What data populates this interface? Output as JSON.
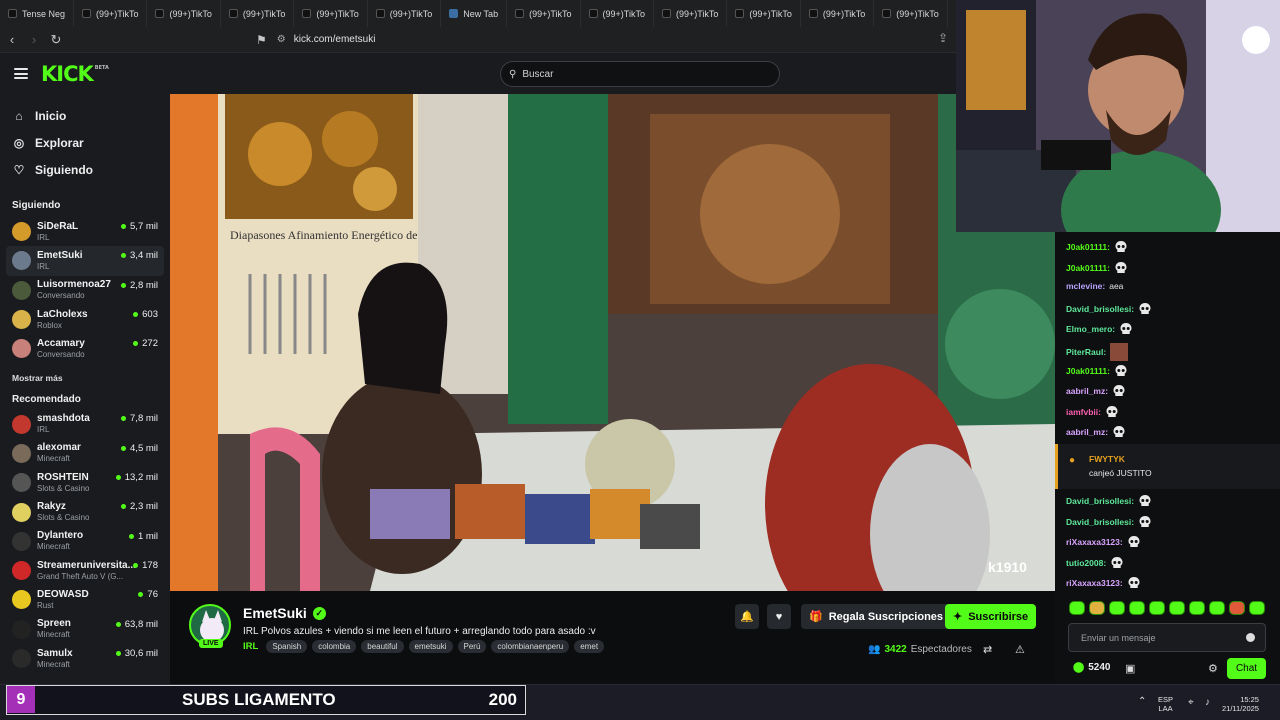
{
  "browser": {
    "tabs": [
      {
        "label": "Tense Neg",
        "icon": "tense-icon"
      },
      {
        "label": "(99+)TikTo",
        "icon": "tiktok-icon"
      },
      {
        "label": "(99+)TikTo",
        "icon": "tiktok-icon"
      },
      {
        "label": "(99+)TikTo",
        "icon": "tiktok-icon"
      },
      {
        "label": "(99+)TikTo",
        "icon": "tiktok-icon"
      },
      {
        "label": "(99+)TikTo",
        "icon": "tiktok-icon"
      },
      {
        "label": "New Tab",
        "icon": "new-tab-icon"
      },
      {
        "label": "(99+)TikTo",
        "icon": "tiktok-icon"
      },
      {
        "label": "(99+)TikTo",
        "icon": "tiktok-icon"
      },
      {
        "label": "(99+)TikTo",
        "icon": "tiktok-icon"
      },
      {
        "label": "(99+)TikTo",
        "icon": "tiktok-icon"
      },
      {
        "label": "(99+)TikTo",
        "icon": "tiktok-icon"
      },
      {
        "label": "(99+)TikTo",
        "icon": "tiktok-icon"
      }
    ],
    "url": "kick.com/emetsuki"
  },
  "header": {
    "logo": "KICK",
    "logo_badge": "BETA",
    "search_placeholder": "Buscar"
  },
  "sidebar": {
    "nav": [
      {
        "label": "Inicio",
        "icon": "home-icon"
      },
      {
        "label": "Explorar",
        "icon": "compass-icon"
      },
      {
        "label": "Siguiendo",
        "icon": "heart-icon"
      }
    ],
    "following_title": "Siguiendo",
    "following": [
      {
        "name": "SiDeRaL",
        "category": "IRL",
        "viewers": "5,7 mil",
        "color": "#d49a2a"
      },
      {
        "name": "EmetSuki",
        "category": "IRL",
        "viewers": "3,4 mil",
        "color": "#6b7a8c"
      },
      {
        "name": "Luisormenoa27",
        "category": "Conversando",
        "viewers": "2,8 mil",
        "color": "#4a5a3a"
      },
      {
        "name": "LaCholexs",
        "category": "Roblox",
        "viewers": "603",
        "color": "#d9b34a"
      },
      {
        "name": "Accamary",
        "category": "Conversando",
        "viewers": "272",
        "color": "#c7807a"
      }
    ],
    "show_more": "Mostrar más",
    "recommended_title": "Recomendado",
    "recommended": [
      {
        "name": "smashdota",
        "category": "IRL",
        "viewers": "7,8 mil",
        "color": "#c2382e"
      },
      {
        "name": "alexomar",
        "category": "Minecraft",
        "viewers": "4,5 mil",
        "color": "#7a6a5a"
      },
      {
        "name": "ROSHTEIN",
        "category": "Slots & Casino",
        "viewers": "13,2 mil",
        "color": "#555555"
      },
      {
        "name": "Rakyz",
        "category": "Slots & Casino",
        "viewers": "2,3 mil",
        "color": "#e0d060"
      },
      {
        "name": "Dylantero",
        "category": "Minecraft",
        "viewers": "1 mil",
        "color": "#333333"
      },
      {
        "name": "Streameruniversita...",
        "category": "Grand Theft Auto V (G...",
        "viewers": "178",
        "color": "#d02828"
      },
      {
        "name": "DEOWASD",
        "category": "Rust",
        "viewers": "76",
        "color": "#e8c820"
      },
      {
        "name": "Spreen",
        "category": "Minecraft",
        "viewers": "63,8 mil",
        "color": "#222222"
      },
      {
        "name": "Samulx",
        "category": "Minecraft",
        "viewers": "30,6 mil",
        "color": "#2a2a2a"
      }
    ]
  },
  "stream": {
    "streamer": "EmetSuki",
    "live_badge": "LIVE",
    "title": "IRL Polvos azules + viendo si me leen el futuro + arreglando todo para asado :v",
    "category": "IRL",
    "tags": [
      "Spanish",
      "colombia",
      "beautiful",
      "emetsuki",
      "Perú",
      "colombianaenperu",
      "emet"
    ],
    "gift_subs_label": "Regala Suscripciones",
    "subscribe_label": "Suscribirse",
    "viewer_count": "3422",
    "viewer_label": "Espectadores",
    "video_overlay_text": "Diapasones Afinamiento Energético de cha",
    "video_corner_logo": "k1910"
  },
  "chat": {
    "messages": [
      {
        "user": "J0ak01111:",
        "text": "",
        "color": "#53fc18",
        "skull": true
      },
      {
        "user": "J0ak01111:",
        "text": "",
        "color": "#53fc18",
        "skull": true
      },
      {
        "user": "mclevine:",
        "text": "aea",
        "color": "#b8a4ff",
        "skull": false
      },
      {
        "user": "David_brisollesi:",
        "text": "",
        "color": "#5ee89a",
        "skull": true
      },
      {
        "user": "Elmo_mero:",
        "text": "",
        "color": "#5ee89a",
        "skull": true
      },
      {
        "user": "PiterRaul:",
        "text": "",
        "color": "#5ee89a",
        "skull": false,
        "emote": true
      },
      {
        "user": "J0ak01111:",
        "text": "",
        "color": "#53fc18",
        "skull": true
      },
      {
        "user": "aabril_mz:",
        "text": "",
        "color": "#d9a4ff",
        "skull": true
      },
      {
        "user": "iamfvbii:",
        "text": "",
        "color": "#ff5fb0",
        "skull": true
      },
      {
        "user": "aabril_mz:",
        "text": "",
        "color": "#d9a4ff",
        "skull": true
      }
    ],
    "redeem_user": "FWYTYK",
    "redeem_text": "canjeó JUSTITO",
    "messages2": [
      {
        "user": "David_brisollesi:",
        "color": "#5ee89a"
      },
      {
        "user": "David_brisollesi:",
        "color": "#5ee89a"
      },
      {
        "user": "riXaxaxa3123:",
        "color": "#d9a4ff"
      },
      {
        "user": "tutio2008:",
        "color": "#5ee89a"
      },
      {
        "user": "riXaxaxa3123:",
        "color": "#d9a4ff"
      }
    ],
    "input_placeholder": "Enviar un mensaje",
    "points": "5240",
    "chat_button": "Chat"
  },
  "overlay": {
    "subs_index": "9",
    "subs_label": "SUBS LIGAMENTO",
    "subs_value": "200"
  },
  "taskbar": {
    "lang_top": "ESP",
    "lang_bottom": "LAA",
    "time": "15:25",
    "date": "21/11/2025"
  },
  "colors": {
    "accent": "#53fc18",
    "bg": "#0b0e0f",
    "sidebar": "#191b1f"
  }
}
